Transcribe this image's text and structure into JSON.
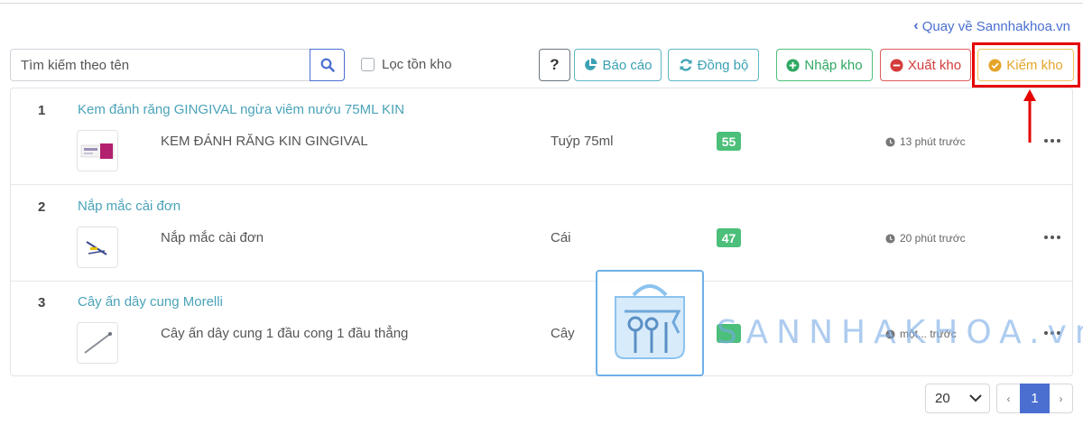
{
  "back_link": {
    "label": "Quay về Sannhakhoa.vn"
  },
  "search": {
    "placeholder": "Tìm kiếm theo tên",
    "value": ""
  },
  "filter": {
    "label": "Lọc tồn kho",
    "checked": false
  },
  "toolbar": {
    "help_label": "?",
    "report_label": "Báo cáo",
    "sync_label": "Đồng bộ",
    "import_label": "Nhập kho",
    "export_label": "Xuất kho",
    "check_label": "Kiểm kho"
  },
  "items": [
    {
      "index": "1",
      "title": "Kem đánh răng GINGIVAL ngừa viêm nướu 75ML KIN",
      "name": "KEM ĐÁNH RĂNG KIN GINGIVAL",
      "unit": "Tuýp 75ml",
      "qty": "55",
      "time": "13 phút trước"
    },
    {
      "index": "2",
      "title": "Nắp mắc cài đơn",
      "name": "Nắp mắc cài đơn",
      "unit": "Cái",
      "qty": "47",
      "time": "20 phút trước"
    },
    {
      "index": "3",
      "title": "Cây ấn dây cung Morelli",
      "name": "Cây ấn dây cung 1 đầu cong 1 đầu thẳng",
      "unit": "Cây",
      "qty": "",
      "time": "một... trước"
    }
  ],
  "watermark": {
    "text": "SANNHAKHOA.vn"
  },
  "pagination": {
    "page_size": "20",
    "current_page": "1",
    "prev": "‹",
    "next": "›"
  },
  "colors": {
    "primary": "#4a6fd1",
    "info": "#3aa2b3",
    "success": "#4cbf7a",
    "danger": "#d43b3b",
    "warning": "#e5a52a",
    "highlight": "#e60000"
  }
}
